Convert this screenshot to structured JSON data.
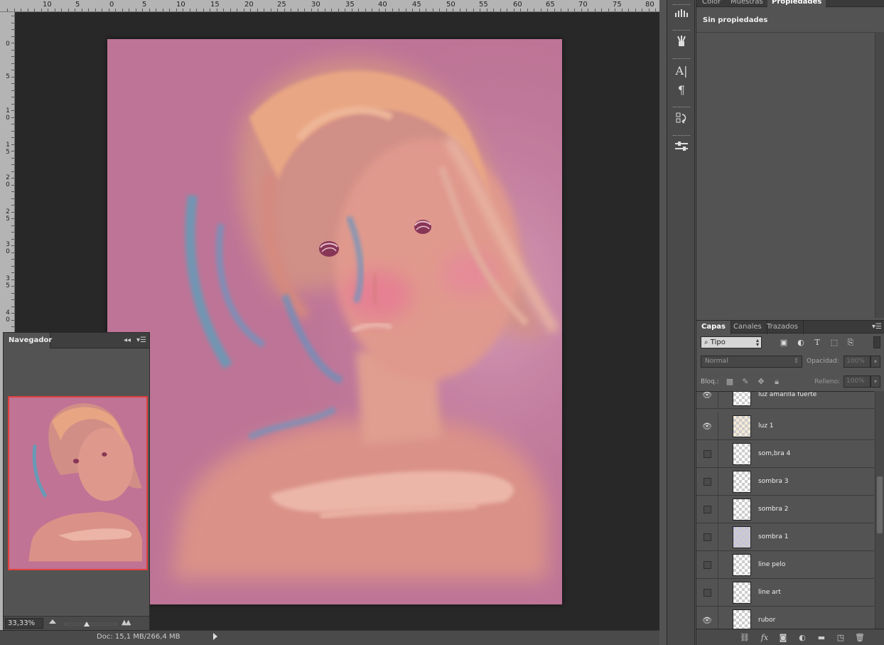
{
  "ruler_top": {
    "labels": [
      "10",
      "5",
      "0",
      "5",
      "10",
      "15",
      "20",
      "25",
      "30",
      "35",
      "40",
      "45",
      "50",
      "55",
      "60",
      "65",
      "70",
      "75",
      "80"
    ]
  },
  "ruler_left": {
    "labels": [
      "0",
      "5",
      "10",
      "15",
      "20",
      "25",
      "30",
      "35",
      "40"
    ]
  },
  "navigator": {
    "title": "Navegador",
    "zoom": "33,33%",
    "collapse_glyph": "◂◂",
    "menu_glyph": "▾☰"
  },
  "statusbar": {
    "doc": "Doc: 15,1 MB/266,4 MB"
  },
  "properties_panel": {
    "tabs": [
      "Color",
      "Muestras",
      "Propiedades"
    ],
    "active_tab": "Propiedades",
    "empty_text": "Sin propiedades"
  },
  "layers_panel": {
    "tabs": [
      "Capas",
      "Canales",
      "Trazados"
    ],
    "active_tab": "Capas",
    "filter_kind": "Tipo",
    "blend_mode": "Normal",
    "opacity_label": "Opacidad:",
    "opacity_value": "100%",
    "lock_label": "Bloq.:",
    "fill_label": "Relleno:",
    "fill_value": "100%",
    "layers": [
      {
        "name": "luz amarilla fuerte",
        "visible": true
      },
      {
        "name": "luz 1",
        "visible": true
      },
      {
        "name": "som,bra 4",
        "visible": false
      },
      {
        "name": "sombra 3",
        "visible": false
      },
      {
        "name": "sombra 2",
        "visible": false
      },
      {
        "name": "sombra 1",
        "visible": false
      },
      {
        "name": "line pelo",
        "visible": false
      },
      {
        "name": "line art",
        "visible": false
      },
      {
        "name": "rubor",
        "visible": true
      }
    ]
  },
  "colors": {
    "canvas_bg": "#bd7697",
    "workspace_bg": "#282828",
    "panel_bg": "#535353",
    "nav_frame": "#e0413b"
  },
  "icons": {
    "tools": [
      "brush-presets-icon",
      "brush-icon",
      "character-icon",
      "paragraph-icon",
      "history-icon",
      "adjustments-icon"
    ],
    "layer_filters": [
      "image-filter-icon",
      "adjustment-filter-icon",
      "type-filter-icon",
      "shape-filter-icon",
      "smart-object-filter-icon"
    ],
    "locks": [
      "lock-transparency-icon",
      "lock-pixels-icon",
      "lock-position-icon",
      "lock-all-icon"
    ],
    "footer": [
      "link-layers-icon",
      "fx-icon",
      "mask-icon",
      "adjustment-layer-icon",
      "group-folder-icon",
      "new-layer-icon",
      "trash-icon"
    ]
  }
}
